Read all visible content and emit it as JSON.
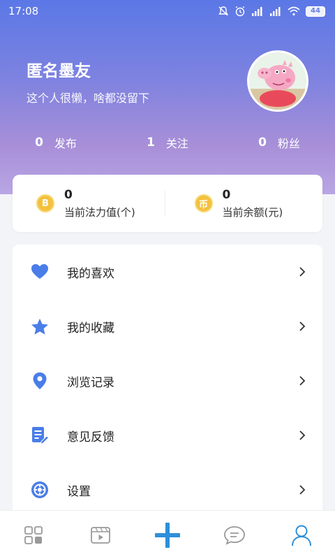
{
  "status_bar": {
    "time": "17:08",
    "battery": "44"
  },
  "profile": {
    "name": "匿名墨友",
    "bio": "这个人很懒，啥都没留下",
    "avatar_icon": "avatar-image"
  },
  "stats": [
    {
      "count": "0",
      "label": "发布"
    },
    {
      "count": "1",
      "label": "关注"
    },
    {
      "count": "0",
      "label": "粉丝"
    }
  ],
  "wallet": [
    {
      "value": "0",
      "label": "当前法力值(个)",
      "coin_text": "B"
    },
    {
      "value": "0",
      "label": "当前余额(元)",
      "coin_text": "币"
    }
  ],
  "menu": [
    {
      "label": "我的喜欢",
      "icon": "heart-icon"
    },
    {
      "label": "我的收藏",
      "icon": "star-icon"
    },
    {
      "label": "浏览记录",
      "icon": "location-pin-icon"
    },
    {
      "label": "意见反馈",
      "icon": "feedback-edit-icon"
    },
    {
      "label": "设置",
      "icon": "settings-icon"
    }
  ],
  "tabbar": {
    "items": [
      {
        "icon": "grid-icon",
        "active": false
      },
      {
        "icon": "video-icon",
        "active": false
      },
      {
        "icon": "plus-icon",
        "active": false
      },
      {
        "icon": "message-icon",
        "active": false
      },
      {
        "icon": "profile-icon",
        "active": true
      }
    ]
  },
  "colors": {
    "accent": "#4a7de8",
    "header_top": "#5b78e6",
    "header_bottom": "#b9a6e4",
    "coin": "#f3c13c"
  }
}
